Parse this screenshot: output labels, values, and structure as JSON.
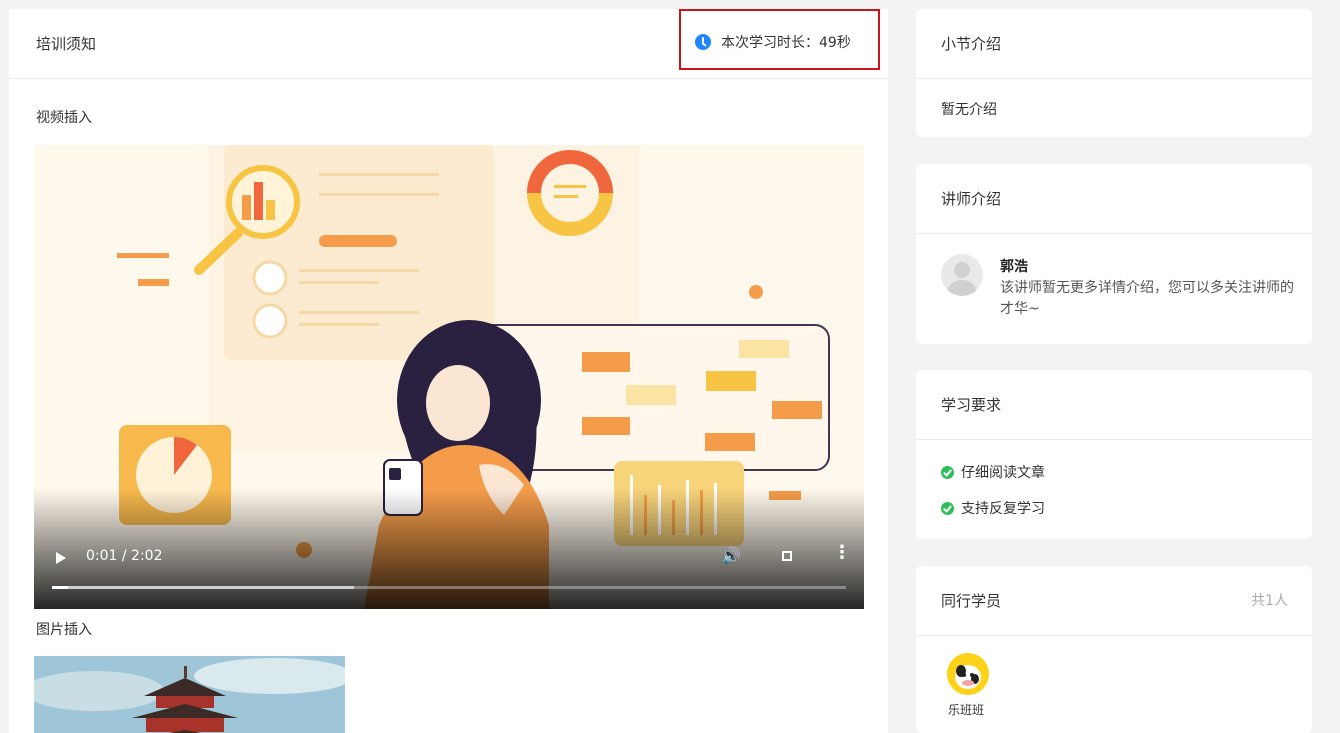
{
  "main": {
    "title": "培训须知",
    "timer": {
      "label": "本次学习时长：",
      "value": "49秒",
      "accent": "#1f86ff",
      "highlight": "#c8141a"
    },
    "video_section": {
      "label": "视频插入",
      "player": {
        "time": "0:01 / 2:02",
        "played_fraction": 0.02,
        "buffered_fraction": 0.38,
        "icons": [
          "play-icon",
          "volume-icon",
          "fullscreen-icon",
          "more-icon"
        ]
      }
    },
    "image_section": {
      "label": "图片插入"
    }
  },
  "sidebar": {
    "section_intro": {
      "title": "小节介绍",
      "text": "暂无介绍"
    },
    "teacher_intro": {
      "title": "讲师介绍",
      "name": "郭浩",
      "desc": "该讲师暂无更多详情介绍，您可以多关注讲师的才华~"
    },
    "requirements": {
      "title": "学习要求",
      "items": [
        "仔细阅读文章",
        "支持反复学习"
      ],
      "check_color": "#2fbd5b"
    },
    "peers": {
      "title": "同行学员",
      "count": "共1人",
      "members": [
        {
          "name": "乐班班"
        }
      ]
    }
  }
}
